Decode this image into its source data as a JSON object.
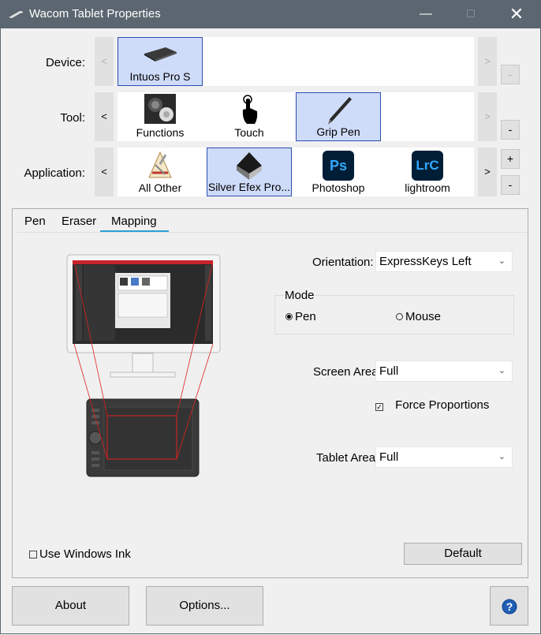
{
  "window": {
    "title": "Wacom Tablet Properties"
  },
  "rows": {
    "device_label": "Device:",
    "tool_label": "Tool:",
    "application_label": "Application:"
  },
  "nav": {
    "prev": "<",
    "next": ">",
    "plus": "+",
    "minus": "-"
  },
  "devices": [
    {
      "label": "Intuos Pro S",
      "selected": true
    }
  ],
  "tools": [
    {
      "label": "Functions",
      "selected": false
    },
    {
      "label": "Touch",
      "selected": false
    },
    {
      "label": "Grip Pen",
      "selected": true
    }
  ],
  "applications": [
    {
      "label": "All Other",
      "selected": false
    },
    {
      "label": "Silver Efex Pro...",
      "selected": true
    },
    {
      "label": "Photoshop",
      "selected": false,
      "badge": "Ps"
    },
    {
      "label": "lightroom",
      "selected": false,
      "badge": "LrC"
    }
  ],
  "tabs": [
    {
      "label": "Pen",
      "active": false
    },
    {
      "label": "Eraser",
      "active": false
    },
    {
      "label": "Mapping",
      "active": true
    }
  ],
  "mapping": {
    "orientation_label": "Orientation:",
    "orientation_value": "ExpressKeys Left",
    "mode_label": "Mode",
    "mode_pen": "Pen",
    "mode_mouse": "Mouse",
    "mode_selected": "Pen",
    "screen_area_label": "Screen Area:",
    "screen_area_value": "Full",
    "force_proportions": "Force Proportions",
    "force_proportions_checked": true,
    "tablet_area_label": "Tablet Area:",
    "tablet_area_value": "Full",
    "use_windows_ink": "Use Windows Ink",
    "use_windows_ink_checked": false,
    "default_button": "Default"
  },
  "footer": {
    "about": "About",
    "options": "Options...",
    "help_icon": "question-mark-icon"
  },
  "colors": {
    "titlebar": "#5b6670",
    "selection": "#cfdcf9",
    "selection_border": "#2f4eb0",
    "tab_accent": "#2a9fd8",
    "mapping_lines": "#e02020",
    "ps_badge": "#001e36",
    "ps_text": "#31a8ff",
    "lrc_badge": "#001e36",
    "lrc_text": "#31a8ff",
    "help_icon": "#1e5fb4"
  }
}
